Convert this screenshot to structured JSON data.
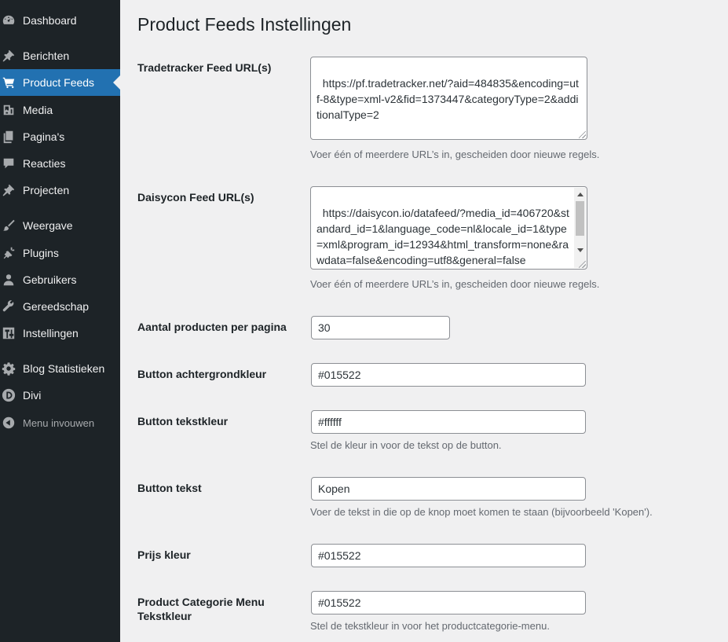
{
  "sidebar": {
    "items": [
      {
        "label": "Dashboard",
        "icon": "dashboard-icon"
      },
      {
        "label": "Berichten",
        "icon": "pin-icon"
      },
      {
        "label": "Product Feeds",
        "icon": "cart-icon",
        "active": true
      },
      {
        "label": "Media",
        "icon": "media-icon"
      },
      {
        "label": "Pagina's",
        "icon": "pages-icon"
      },
      {
        "label": "Reacties",
        "icon": "comment-icon"
      },
      {
        "label": "Projecten",
        "icon": "pin-icon"
      },
      {
        "label": "Weergave",
        "icon": "brush-icon"
      },
      {
        "label": "Plugins",
        "icon": "plugin-icon"
      },
      {
        "label": "Gebruikers",
        "icon": "user-icon"
      },
      {
        "label": "Gereedschap",
        "icon": "wrench-icon"
      },
      {
        "label": "Instellingen",
        "icon": "settings-icon"
      },
      {
        "label": "Blog Statistieken",
        "icon": "gear-icon"
      },
      {
        "label": "Divi",
        "icon": "divi-icon"
      },
      {
        "label": "Menu invouwen",
        "icon": "collapse-icon"
      }
    ],
    "accent_color": "#2271b1"
  },
  "page": {
    "title": "Product Feeds Instellingen"
  },
  "fields": {
    "tradetracker": {
      "label": "Tradetracker Feed URL(s)",
      "value": "https://pf.tradetracker.net/?aid=484835&encoding=utf-8&type=xml-v2&fid=1373447&categoryType=2&additionalType=2",
      "description": "Voer één of meerdere URL’s in, gescheiden door nieuwe regels."
    },
    "daisycon": {
      "label": "Daisycon Feed URL(s)",
      "value": "https://daisycon.io/datafeed/?media_id=406720&standard_id=1&language_code=nl&locale_id=1&type=xml&program_id=12934&html_transform=none&rawdata=false&encoding=utf8&general=false",
      "description": "Voer één of meerdere URL’s in, gescheiden door nieuwe regels."
    },
    "per_page": {
      "label": "Aantal producten per pagina",
      "value": "30"
    },
    "button_bg": {
      "label": "Button achtergrondkleur",
      "value": "#015522"
    },
    "button_text_color": {
      "label": "Button tekstkleur",
      "value": "#ffffff",
      "description": "Stel de kleur in voor de tekst op de button."
    },
    "button_text": {
      "label": "Button tekst",
      "value": "Kopen",
      "description": "Voer de tekst in die op de knop moet komen te staan (bijvoorbeeld 'Kopen')."
    },
    "price_color": {
      "label": "Prijs kleur",
      "value": "#015522"
    },
    "category_menu_color": {
      "label_line1": "Product Categorie Menu",
      "label_line2": "Tekstkleur",
      "value": "#015522",
      "description": "Stel de tekstkleur in voor het productcategorie-menu."
    }
  }
}
